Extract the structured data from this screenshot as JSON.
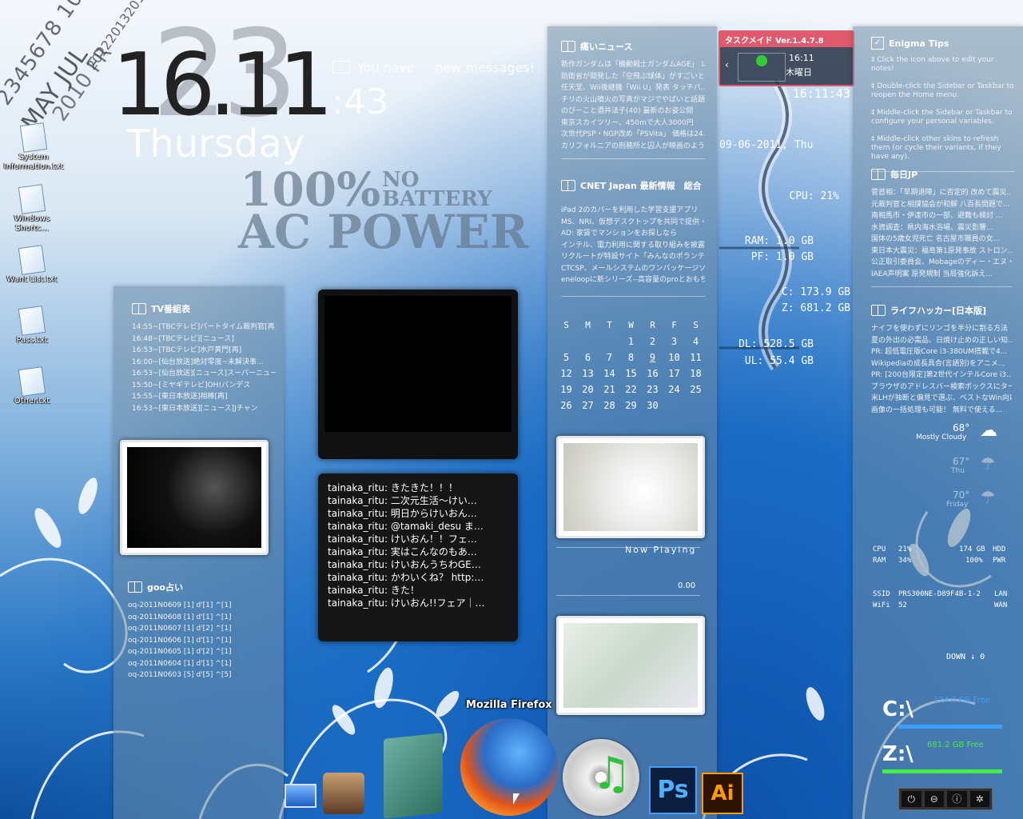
{
  "clock": {
    "day_big": "23",
    "time": "16.11",
    "seconds": ":43",
    "weekday": "Thursday",
    "messages_text": "You have     new messages!",
    "diagonal_text_1": "2345678 101112",
    "diagonal_text_2": "MAY JUL",
    "diagonal_text_3": "2010 FR",
    "diagonal_text_4": "201220132019"
  },
  "battery": {
    "percent": "100%",
    "no": "NO",
    "battery": "BATTERY",
    "ac": "AC POWER"
  },
  "desktop_icons": [
    {
      "label": "System Information.txt"
    },
    {
      "label": "Windows Shortc..."
    },
    {
      "label": "Want List.txt"
    },
    {
      "label": "Pass.txt"
    },
    {
      "label": "Other.txt"
    }
  ],
  "tv_panel": {
    "title": "TV番組表",
    "items": [
      "14:55~[TBCテレビ]パートタイム裁判官[再]",
      "16:48~[TBCテレビ][ニュース]",
      "16:53~[TBCテレビ]水戸黄門[再]",
      "16:00~[仙台放送]絶対零度~未解決事...",
      "16:53~[仙台放送][ニュース]スーパーニュース",
      "15:50~[ミヤギテレビ]OH!バンデス",
      "15:55~[東日本放送]相棒[再]",
      "16:53~[東日本放送][ニュース]Jチャン"
    ]
  },
  "goo_panel": {
    "title": "goo占い",
    "items": [
      "oq-2011N0609  [1]  d'[1]  ^[1]",
      "oq-2011N0608  [1]  d'[1]  ^[1]",
      "oq-2011N0607  [1]  d'[2]  ^[1]",
      "oq-2011N0606  [1]  d'[1]  ^[1]",
      "oq-2011N0605  [1]  d'[2]  ^[1]",
      "oq-2011N0604  [1]  d'[1]  ^[1]",
      "oq-2011N0603  [5]  d'[5]  ^[5]"
    ]
  },
  "tweets": [
    "tainaka_ritu: きたきた！！！",
    "tainaka_ritu: 二次元生活～けい…",
    "tainaka_ritu: 明日からけいおん…",
    "tainaka_ritu: @tamaki_desu ま…",
    "tainaka_ritu: けいおん！！フェ…",
    "tainaka_ritu: 実はこんなのもあ…",
    "tainaka_ritu: けいおんうちわGE…",
    "tainaka_ritu: かわいくね？ http:…",
    "tainaka_ritu: きた！",
    "tainaka_ritu: けいおん!!フェア｜…"
  ],
  "news_panel": {
    "title": "痛いニュース",
    "items": [
      "新作ガンダムは「機動戦士ガンダムAGE」 レ...",
      "防衛省が開発した「空飛ぶ球体」がすごいと...",
      "任天堂、Wii後継機「Wii U」発表  タッチパ...",
      "チリの火山噴火の写真がマジでやばいと話題に",
      "のびーこと酒井法子(40) 最新のお姿公開",
      "東京スカイツリー、450mで大人3000円",
      "次世代PSP・NGP改め「PSVita」 価格は24...",
      "カリフォルニアの刑務所と囚人が映画のようだ..."
    ]
  },
  "cnet_panel": {
    "title": "CNET Japan 最新情報　総合",
    "items": [
      "iPad 2のカバーを利用した学習支援アプリ",
      "MS、NRI、仮想デスクトップを共同で提供・N...",
      "AD: 家賃でマンションをお探しなら",
      "インテル、電力利用に関する取り組みを披露...",
      "リクルートが特設サイト「みんなのボランティア」...",
      "CTCSP、メールシステムのワンパッケージソフト...",
      "eneloopに新シリーズ--高容量のproとおもち..."
    ]
  },
  "calendar": {
    "headers": [
      "S",
      "M",
      "T",
      "W",
      "R",
      "F",
      "S"
    ],
    "cells": [
      "",
      "",
      "",
      "1",
      "2",
      "3",
      "4",
      "5",
      "6",
      "7",
      "8",
      "9",
      "10",
      "11",
      "12",
      "13",
      "14",
      "15",
      "16",
      "17",
      "18",
      "19",
      "20",
      "21",
      "22",
      "23",
      "24",
      "25",
      "26",
      "27",
      "28",
      "29",
      "30",
      "",
      ""
    ],
    "today": "9"
  },
  "now_playing": {
    "label": "Now Playing",
    "value": "0.00"
  },
  "taskmaid": {
    "title": "タスクメイド Ver.1.4.7.8",
    "time": "16:11",
    "day": "木曜日"
  },
  "sysmon": {
    "time": "16:11:43",
    "date": "09-06-2011, Thu",
    "cpu": "CPU: 21%",
    "ram": "RAM: 1.0 GB",
    "pf": "PF: 1.0 GB",
    "c": "C: 173.9 GB",
    "z": "Z: 681.2 GB",
    "dl": "DL: 528.5 GB",
    "ul": "UL: 55.4 GB"
  },
  "enigma": {
    "title": "Enigma Tips",
    "tips": [
      "‡ Click the icon above to edit your notes!",
      "‡ Double-click the Sidebar or Taskbar to reopen the Home menu.",
      "‡ Middle-click the Sidebar or Taskbar to configure your personal variables.",
      "‡ Middle-click other skins to refresh them (or cycle their variants, if they have any)."
    ]
  },
  "mainichi": {
    "title": "毎日JP",
    "items": [
      "菅首相：「早期退陣」に否定的 改めて震災...",
      "元裁判官と相撲協会が和解 八百長問題で...",
      "南相馬市・伊達市の一部、避難も検討 ...",
      "水資調査：県内海水浴場、震災影響...",
      "国体の5歳女児死亡 名古屋市職員の女...",
      "東日本大震災：福島第1原発事故 ストロン...",
      "公正取引委員会、Mobageのディー・エヌ・エ...",
      "IAEA声明案 原発規制 当局強化訴え..."
    ]
  },
  "lifehacker": {
    "title": "ライフハッカー[日本版]",
    "items": [
      "ナイフを使わずにリンゴを半分に割る方法",
      "夏の外出の必需品、日焼け止めの正しい知...",
      "PR: 超低電圧版Core i3-380UM搭載で4...",
      "Wikipediaの成長具合(言語別)をアニメ...",
      "PR: [200台限定]第2世代インテルCore i3...",
      "ブラウザのアドレスバー検索ボックスにターン...",
      "米LHが独断と偏見で選ぶ、ベストなWin向け...",
      "画像の一括処理も可能！ 無料で使える..."
    ]
  },
  "weather": [
    {
      "temp": "68°",
      "desc": "Mostly Cloudy"
    },
    {
      "temp": "67°",
      "desc": "Thu"
    },
    {
      "temp": "70°",
      "desc": "Friday"
    }
  ],
  "stats": {
    "cpu_label": "CPU",
    "cpu_val": "21%",
    "c_val": "174 GB",
    "hdd_label": "HDD",
    "ram_label": "RAM",
    "ram_val": "34%",
    "pwr_val": "100%",
    "pwr_label": "PWR",
    "ssid_label": "SSID",
    "ssid_val": "PRS300NE-D89F4B-1-2",
    "lan_label": "LAN",
    "wifi_label": "WiFi",
    "wifi_val": "52",
    "wan_label": "WAN",
    "down_label": "DOWN ↓ 0"
  },
  "drives": {
    "c_label": "C:\\",
    "c_free": "174.0 GB Free",
    "z_label": "Z:\\",
    "z_free": "681.2 GB Free"
  },
  "dock": {
    "tooltip": "Mozilla Firefox",
    "ps": "Ps",
    "ai": "Ai"
  },
  "colors": {
    "panel": "#6e8ca5",
    "taskmaid_red": "#e05a6e",
    "drive_bar_blue": "#3aa0ff",
    "drive_bar_green": "#44ee44"
  }
}
